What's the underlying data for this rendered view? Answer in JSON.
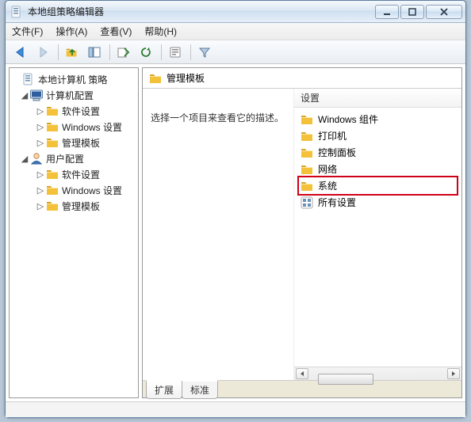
{
  "window": {
    "title": "本地组策略编辑器"
  },
  "menu": {
    "file": "文件(F)",
    "action": "操作(A)",
    "view": "查看(V)",
    "help": "帮助(H)"
  },
  "tree": {
    "root": "本地计算机 策略",
    "computer": "计算机配置",
    "user": "用户配置",
    "software": "软件设置",
    "windows_settings": "Windows 设置",
    "admin_templates": "管理模板"
  },
  "right": {
    "header": "管理模板",
    "desc": "选择一个项目来查看它的描述。",
    "settings_col": "设置",
    "items": {
      "windows_components": "Windows 组件",
      "printers": "打印机",
      "control_panel": "控制面板",
      "network": "网络",
      "system": "系统",
      "all_settings": "所有设置"
    }
  },
  "tabs": {
    "extended": "扩展",
    "standard": "标准"
  }
}
